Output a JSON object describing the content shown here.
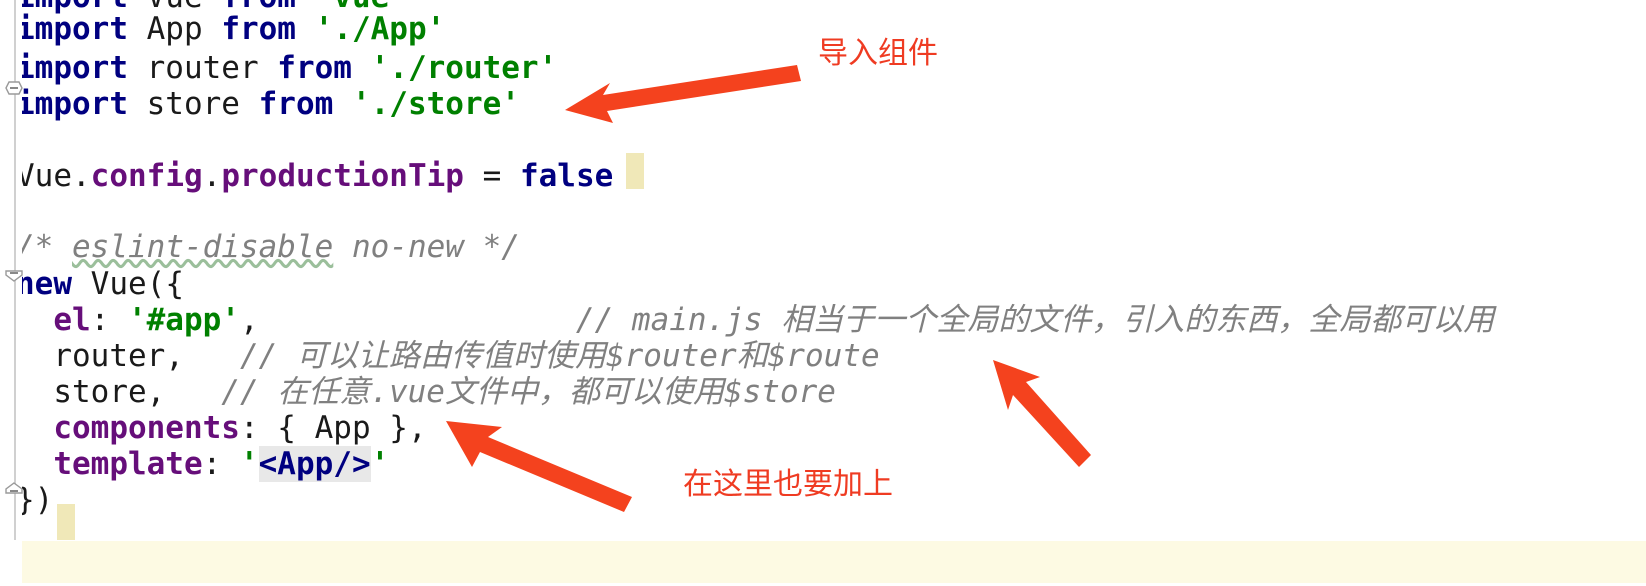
{
  "editor": {
    "file_kind": "javascript",
    "background": "#ffffff",
    "current_line_highlight": "#fdfae3",
    "caret_block_color": "#f0e8b8",
    "lines": [
      {
        "id": "line-import-vue",
        "clipped": true,
        "text": "import Vue from 'vue'",
        "tokens": [
          {
            "t": "import",
            "c": "kw"
          },
          {
            "t": " Vue ",
            "c": "plain"
          },
          {
            "t": "from",
            "c": "kw"
          },
          {
            "t": " ",
            "c": "plain"
          },
          {
            "t": "'vue'",
            "c": "str"
          }
        ]
      },
      {
        "id": "line-import-app",
        "text": "import App from './App'",
        "tokens": [
          {
            "t": "import",
            "c": "kw"
          },
          {
            "t": " App ",
            "c": "plain"
          },
          {
            "t": "from",
            "c": "kw"
          },
          {
            "t": " ",
            "c": "plain"
          },
          {
            "t": "'./App'",
            "c": "str"
          }
        ]
      },
      {
        "id": "line-import-router",
        "text": "import router from './router'",
        "tokens": [
          {
            "t": "import",
            "c": "kw"
          },
          {
            "t": " router ",
            "c": "plain"
          },
          {
            "t": "from",
            "c": "kw"
          },
          {
            "t": " ",
            "c": "plain"
          },
          {
            "t": "'./router'",
            "c": "str"
          }
        ]
      },
      {
        "id": "line-import-store",
        "text": "import store from './store'",
        "tokens": [
          {
            "t": "import",
            "c": "kw"
          },
          {
            "t": " store ",
            "c": "plain"
          },
          {
            "t": "from",
            "c": "kw"
          },
          {
            "t": " ",
            "c": "plain"
          },
          {
            "t": "'./store'",
            "c": "str"
          }
        ]
      },
      {
        "id": "line-blank-1",
        "text": "",
        "tokens": []
      },
      {
        "id": "line-production-tip",
        "text": "Vue.config.productionTip = false",
        "tokens": [
          {
            "t": "Vue",
            "c": "plain"
          },
          {
            "t": ".",
            "c": "plain"
          },
          {
            "t": "config",
            "c": "prop"
          },
          {
            "t": ".",
            "c": "plain"
          },
          {
            "t": "productionTip",
            "c": "prop"
          },
          {
            "t": " = ",
            "c": "plain"
          },
          {
            "t": "false",
            "c": "kw"
          }
        ]
      },
      {
        "id": "line-blank-2",
        "text": "",
        "tokens": []
      },
      {
        "id": "line-eslint-disable",
        "text": "/* eslint-disable no-new */",
        "tokens": [
          {
            "t": "/* ",
            "c": "comment"
          },
          {
            "t": "eslint-disable",
            "c": "comment squig"
          },
          {
            "t": " no-new */",
            "c": "comment"
          }
        ]
      },
      {
        "id": "line-new-vue",
        "text": "new Vue({",
        "tokens": [
          {
            "t": "new",
            "c": "kw"
          },
          {
            "t": " Vue({",
            "c": "plain"
          }
        ]
      },
      {
        "id": "line-el",
        "text": "  el: '#app',                 // main.js 相当于一个全局的文件，引入的东西，全局都可以用",
        "tokens": [
          {
            "t": "  ",
            "c": "plain"
          },
          {
            "t": "el",
            "c": "prop"
          },
          {
            "t": ": ",
            "c": "plain"
          },
          {
            "t": "'#app'",
            "c": "str"
          },
          {
            "t": ",",
            "c": "plain"
          },
          {
            "t": "                 ",
            "c": "plain"
          },
          {
            "t": "// main.js ",
            "c": "comment"
          },
          {
            "t": "相当于一个全局的文件，引入的东西，全局都可以用",
            "c": "ctext"
          }
        ]
      },
      {
        "id": "line-router",
        "text": "  router,   // 可以让路由传值时使用$router和$route",
        "tokens": [
          {
            "t": "  router,  ",
            "c": "plain"
          },
          {
            "t": " // ",
            "c": "comment"
          },
          {
            "t": "可以让路由传值时使用",
            "c": "ctext"
          },
          {
            "t": "$router",
            "c": "comment"
          },
          {
            "t": "和",
            "c": "ctext"
          },
          {
            "t": "$route",
            "c": "comment"
          }
        ]
      },
      {
        "id": "line-store",
        "text": "  store,   // 在任意.vue文件中，都可以使用$store",
        "tokens": [
          {
            "t": "  store,  ",
            "c": "plain"
          },
          {
            "t": " // ",
            "c": "comment"
          },
          {
            "t": "在任意",
            "c": "ctext"
          },
          {
            "t": ".vue",
            "c": "comment"
          },
          {
            "t": "文件中，都可以使用",
            "c": "ctext"
          },
          {
            "t": "$store",
            "c": "comment"
          }
        ]
      },
      {
        "id": "line-components",
        "text": "  components: { App },",
        "tokens": [
          {
            "t": "  ",
            "c": "plain"
          },
          {
            "t": "components",
            "c": "prop"
          },
          {
            "t": ": { App },",
            "c": "plain"
          }
        ]
      },
      {
        "id": "line-template",
        "text": "  template: '<App/>'",
        "tokens": [
          {
            "t": "  ",
            "c": "plain"
          },
          {
            "t": "template",
            "c": "prop"
          },
          {
            "t": ": ",
            "c": "plain"
          },
          {
            "t": "'",
            "c": "str"
          },
          {
            "t": "<App/>",
            "c": "tag hl-tag"
          },
          {
            "t": "'",
            "c": "str"
          }
        ]
      },
      {
        "id": "line-close",
        "text": "})",
        "tokens": [
          {
            "t": "})",
            "c": "plain"
          }
        ]
      }
    ],
    "fold_markers": [
      {
        "name": "fold-marker-imports",
        "state": "expanded"
      },
      {
        "name": "fold-marker-new-vue",
        "state": "expanded"
      },
      {
        "name": "fold-marker-close",
        "state": "expanded"
      }
    ],
    "carets": [
      {
        "name": "caret-after-false"
      },
      {
        "name": "caret-after-close-paren"
      }
    ]
  },
  "annotations": {
    "color": "#ef3b22",
    "items": [
      {
        "id": "annotation-import-components",
        "text": "导入组件"
      },
      {
        "id": "annotation-add-here-too",
        "text": "在这里也要加上"
      }
    ],
    "arrows": [
      {
        "id": "arrow-to-imports",
        "direction": "left"
      },
      {
        "id": "arrow-to-el-comment",
        "direction": "up-left"
      },
      {
        "id": "arrow-to-components",
        "direction": "up-left"
      }
    ]
  }
}
